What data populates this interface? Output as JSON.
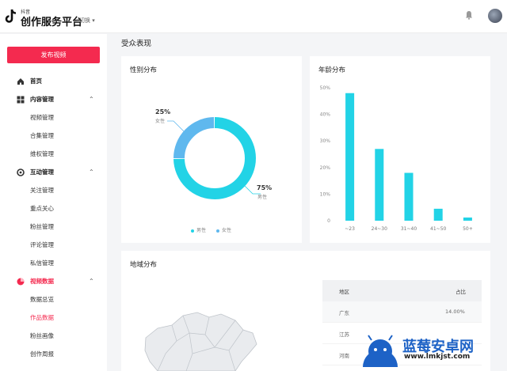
{
  "header": {
    "brand_small": "抖音",
    "brand_title": "创作服务平台",
    "switch_label": "切换"
  },
  "sidebar": {
    "publish_button": "发布视频",
    "items": [
      {
        "label": "首页",
        "icon": "home-icon"
      },
      {
        "label": "内容管理",
        "icon": "grid-icon",
        "chevron": "⌃"
      },
      {
        "label": "视频管理"
      },
      {
        "label": "合集管理"
      },
      {
        "label": "维权管理"
      },
      {
        "label": "互动管理",
        "icon": "interaction-icon",
        "chevron": "⌃"
      },
      {
        "label": "关注管理"
      },
      {
        "label": "重点关心"
      },
      {
        "label": "粉丝管理"
      },
      {
        "label": "评论管理"
      },
      {
        "label": "私信管理"
      },
      {
        "label": "视频数据",
        "icon": "pie-icon",
        "chevron": "⌃"
      },
      {
        "label": "数据总览"
      },
      {
        "label": "作品数据"
      },
      {
        "label": "粉丝画像"
      },
      {
        "label": "创作周报"
      }
    ]
  },
  "main": {
    "title": "受众表现",
    "gender_card": {
      "title": "性别分布",
      "female_pct": "25%",
      "female_label": "女性",
      "male_pct": "75%",
      "male_label": "男性",
      "legend_male": "男性",
      "legend_female": "女性"
    },
    "age_card": {
      "title": "年龄分布"
    },
    "region_card": {
      "title": "地域分布",
      "col_region": "地区",
      "col_share": "占比",
      "rows": [
        {
          "region": "广东",
          "share": "14.00%"
        },
        {
          "region": "江苏",
          "share": ""
        },
        {
          "region": "河南",
          "share": ""
        }
      ]
    }
  },
  "chart_data": [
    {
      "type": "pie",
      "title": "性别分布",
      "categories": [
        "男性",
        "女性"
      ],
      "values": [
        75,
        25
      ],
      "colors": [
        "#22d3e6",
        "#5fb8ee"
      ]
    },
    {
      "type": "bar",
      "title": "年龄分布",
      "categories": [
        "~23",
        "24~30",
        "31~40",
        "41~50",
        "50+"
      ],
      "values": [
        48,
        27,
        18,
        4.5,
        1.2
      ],
      "y_ticks": [
        "0",
        "10%",
        "20%",
        "30%",
        "40%",
        "50%"
      ],
      "ylim": [
        0,
        50
      ],
      "color": "#22d3e6"
    }
  ],
  "watermark": {
    "text": "蓝莓安卓网",
    "url": "www.lmkjst.com"
  },
  "colors": {
    "accent": "#f42a4f",
    "chart": "#22d3e6",
    "chart_light": "#5fb8ee"
  }
}
